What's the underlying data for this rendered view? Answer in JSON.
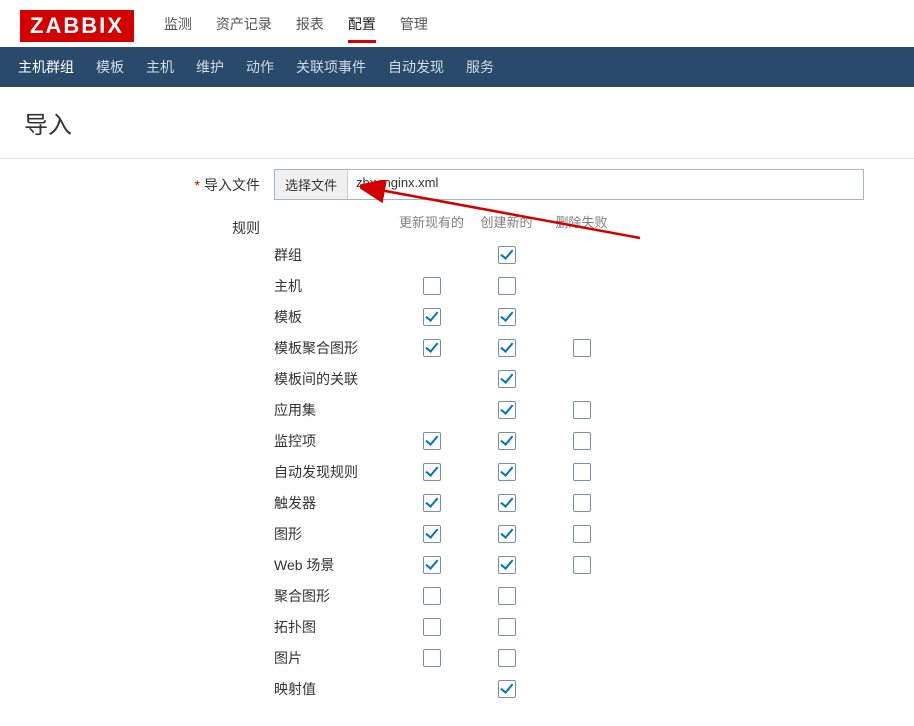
{
  "logo": "ZABBIX",
  "topnav": {
    "items": [
      "监测",
      "资产记录",
      "报表",
      "配置",
      "管理"
    ],
    "active_index": 3
  },
  "subnav": {
    "items": [
      "主机群组",
      "模板",
      "主机",
      "维护",
      "动作",
      "关联项事件",
      "自动发现",
      "服务"
    ],
    "active_index": 0
  },
  "page_title": "导入",
  "form": {
    "import_file_label": "导入文件",
    "choose_file_btn": "选择文件",
    "file_name": "zbx_nginx.xml",
    "rules_label": "规则",
    "cols": {
      "update": "更新现有的",
      "create": "创建新的",
      "delete": "删除失败"
    },
    "rules": [
      {
        "label": "群组",
        "update": null,
        "create": true,
        "delete": null
      },
      {
        "label": "主机",
        "update": false,
        "create": false,
        "delete": null
      },
      {
        "label": "模板",
        "update": true,
        "create": true,
        "delete": null
      },
      {
        "label": "模板聚合图形",
        "update": true,
        "create": true,
        "delete": false
      },
      {
        "label": "模板间的关联",
        "update": null,
        "create": true,
        "delete": null
      },
      {
        "label": "应用集",
        "update": null,
        "create": true,
        "delete": false
      },
      {
        "label": "监控项",
        "update": true,
        "create": true,
        "delete": false
      },
      {
        "label": "自动发现规则",
        "update": true,
        "create": true,
        "delete": false
      },
      {
        "label": "触发器",
        "update": true,
        "create": true,
        "delete": false
      },
      {
        "label": "图形",
        "update": true,
        "create": true,
        "delete": false
      },
      {
        "label": "Web 场景",
        "update": true,
        "create": true,
        "delete": false
      },
      {
        "label": "聚合图形",
        "update": false,
        "create": false,
        "delete": null
      },
      {
        "label": "拓扑图",
        "update": false,
        "create": false,
        "delete": null
      },
      {
        "label": "图片",
        "update": false,
        "create": false,
        "delete": null
      },
      {
        "label": "映射值",
        "update": null,
        "create": true,
        "delete": null
      }
    ]
  }
}
